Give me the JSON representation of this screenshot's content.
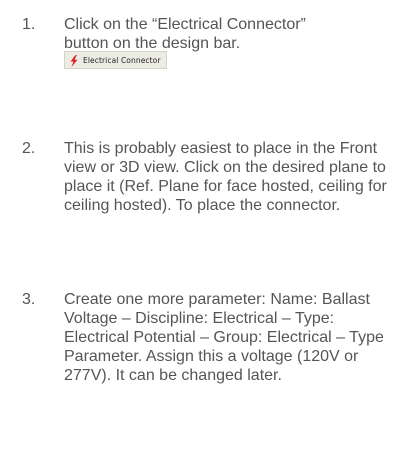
{
  "steps": [
    {
      "number": "1.",
      "text_line1": "Click on the “Electrical Connector”",
      "text_line2": "button on the design bar."
    },
    {
      "number": "2.",
      "text": "This is probably easiest to place in the Front view or 3D view. Click on the desired plane to place it (Ref. Plane for face hosted, ceiling for ceiling hosted). To place the connector."
    },
    {
      "number": "3.",
      "text": "Create one more parameter: Name: Ballast Voltage – Discipline: Electrical – Type: Electrical Potential – Group: Electrical – Type Parameter. Assign this a voltage (120V or 277V). It can be changed later."
    }
  ],
  "design_button": {
    "label": "Electrical Connector",
    "icon": "lightning-bolt-icon",
    "icon_color": "#e02020"
  }
}
